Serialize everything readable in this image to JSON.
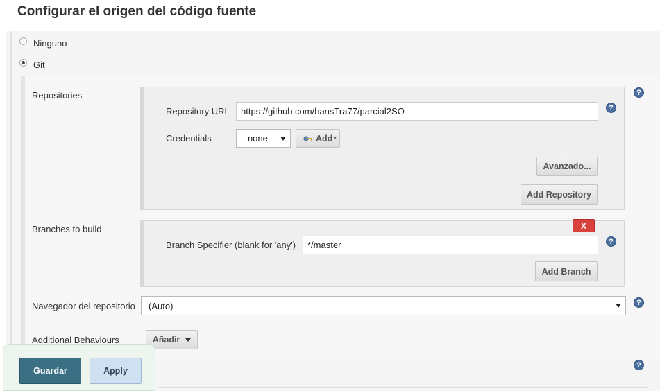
{
  "section": {
    "title": "Configurar el origen del código fuente"
  },
  "scm_options": [
    {
      "label": "Ninguno",
      "selected": false
    },
    {
      "label": "Git",
      "selected": true
    }
  ],
  "repositories": {
    "label": "Repositories",
    "url_label": "Repository URL",
    "url_value": "https://github.com/hansTra77/parcial2SO",
    "credentials_label": "Credentials",
    "credentials_value": "- none -",
    "add_label": "Add",
    "advanced_label": "Avanzado...",
    "add_repository_label": "Add Repository"
  },
  "branches": {
    "label": "Branches to build",
    "delete_label": "X",
    "specifier_label": "Branch Specifier (blank for 'any')",
    "specifier_value": "*/master",
    "add_branch_label": "Add Branch"
  },
  "browser": {
    "label": "Navegador del repositorio",
    "value": "(Auto)"
  },
  "behaviours": {
    "label": "Additional Behaviours",
    "add_label": "Añadir"
  },
  "help_label": "?",
  "actions": {
    "save_label": "Guardar",
    "apply_label": "Apply"
  },
  "colors": {
    "save_button": "#3b6f84",
    "delete_button": "#d9423c",
    "help_icon": "#4b6f9e"
  }
}
